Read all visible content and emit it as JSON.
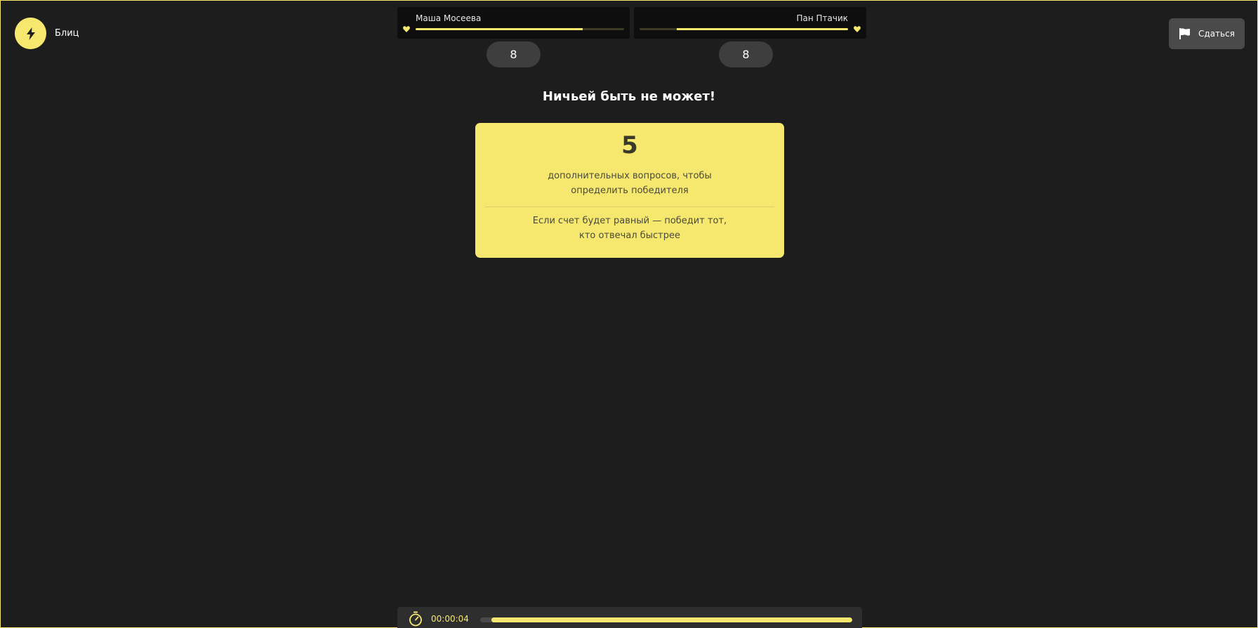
{
  "mode": {
    "label": "Блиц",
    "icon": "lightning-icon"
  },
  "surrender": {
    "label": "Сдаться",
    "icon": "flag-icon"
  },
  "players": [
    {
      "name": "Маша Мосеева",
      "health": 0.8,
      "score": "8"
    },
    {
      "name": "Пан Птачик",
      "health": 0.82,
      "score": "8"
    }
  ],
  "headline": "Ничьей быть не может!",
  "tiebreak": {
    "count": "5",
    "description_line1": "дополнительных вопросов, чтобы",
    "description_line2": "определить победителя",
    "note_line1": "Если счет будет равный — победит тот,",
    "note_line2": "кто отвечал быстрее"
  },
  "timer": {
    "text": "00:00:04",
    "icon": "stopwatch-icon",
    "progress": 0.97
  },
  "colors": {
    "accent": "#f6e86f",
    "background": "#1d1d1d",
    "panel": "#0e0e0e",
    "button": "#4a4a4a"
  }
}
